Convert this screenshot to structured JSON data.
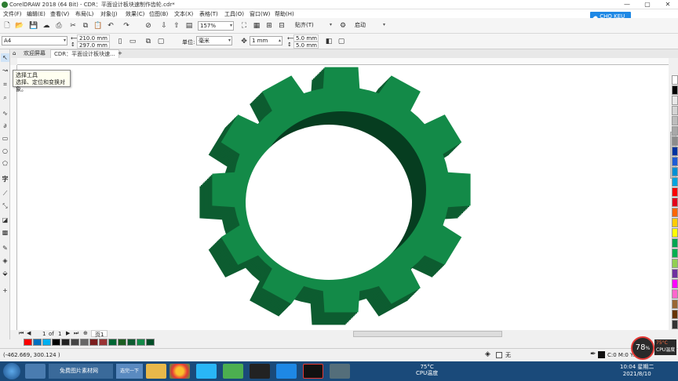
{
  "app": {
    "title": "CorelDRAW 2018 (64 Bit) - CDR：平面设计板块速制作齿轮.cdr*"
  },
  "window_controls": [
    "—",
    "▢",
    "✕"
  ],
  "menu": [
    "文件(F)",
    "编辑(E)",
    "查看(V)",
    "布局(L)",
    "对象(J)",
    "效果(C)",
    "位图(B)",
    "文本(X)",
    "表格(T)",
    "工具(O)",
    "窗口(W)",
    "帮助(H)"
  ],
  "std_toolbar": {
    "zoom": "157%",
    "snap": "贴齐(T)",
    "launch": "启动"
  },
  "cloud_button": "CHO KEU",
  "property_bar": {
    "paper": "A4",
    "width": "210.0 mm",
    "height": "297.0 mm",
    "units_label": "单位:",
    "units": "毫米",
    "nudge": "1 mm",
    "dup_x": "5.0 mm",
    "dup_y": "5.0 mm"
  },
  "doc_tabs": [
    "欢迎屏幕",
    "CDR：平面设计板块速..."
  ],
  "tooltip": {
    "title": "选择工具",
    "desc": "选择、定位和变换对象。"
  },
  "page_nav": {
    "current": "1",
    "sep": "of",
    "total": "1",
    "page_tab": "页1"
  },
  "status": {
    "coords": "(-462.669, 300.124 )",
    "fill_label": "C:0 M:0 Y:",
    "none_label": "无"
  },
  "taskbar": {
    "start_label": "",
    "ie_label": "免费图片素材网",
    "active_label": "选完一下",
    "weather": "75°C",
    "weather_sub": "CPU温度",
    "clock_time": "10:04 星期二",
    "clock_date": "2021/8/10"
  },
  "cpu_widget": {
    "percent": "78",
    "unit": "%",
    "temp": "75°C",
    "label": "CPU温度"
  },
  "colors": {
    "gear_face": "#138a48",
    "gear_side": "#0d5c30",
    "gear_inner": "#063d20",
    "taskbar": "#1a4a7a"
  },
  "palette_colors": [
    "#ffffff",
    "#000000",
    "#e9e9e9",
    "#d4d4d4",
    "#bdbdbd",
    "#a8a8a8",
    "#8c8c8c",
    "#0033a0",
    "#1e5bd6",
    "#0091d5",
    "#00a5e0",
    "#ff0000",
    "#e3001b",
    "#ff6600",
    "#ffcc00",
    "#ffff00",
    "#00a651",
    "#00b050",
    "#92d050",
    "#7030a0",
    "#ff00ff",
    "#ff66cc",
    "#996633",
    "#663300",
    "#333333"
  ],
  "doc_palette_colors": [
    "#ff0000",
    "#0070c0",
    "#00b0f0",
    "#000000",
    "#222222",
    "#444444",
    "#666666",
    "#7b1e1e",
    "#993333",
    "#006633",
    "#1b5e20",
    "#0d5c30",
    "#138a48",
    "#004d26"
  ]
}
